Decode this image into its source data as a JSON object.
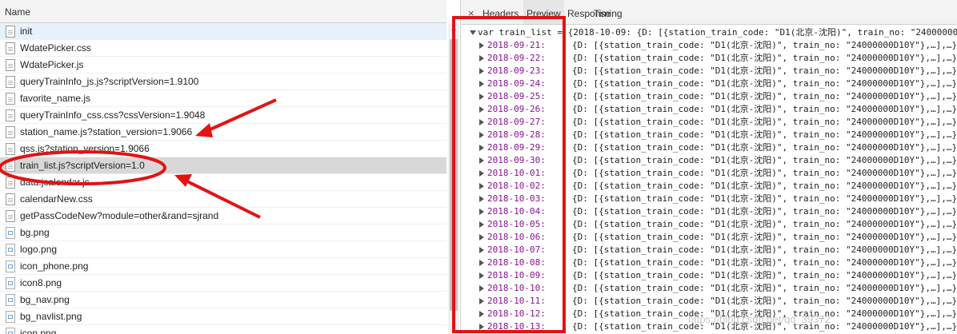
{
  "left_panel": {
    "header": "Name",
    "files": [
      {
        "name": "init",
        "icon": "document-icon"
      },
      {
        "name": "WdatePicker.css",
        "icon": "document-icon"
      },
      {
        "name": "WdatePicker.js",
        "icon": "document-icon"
      },
      {
        "name": "queryTrainInfo_js.js?scriptVersion=1.9100",
        "icon": "document-icon"
      },
      {
        "name": "favorite_name.js",
        "icon": "document-icon"
      },
      {
        "name": "queryTrainInfo_css.css?cssVersion=1.9048",
        "icon": "document-icon"
      },
      {
        "name": "station_name.js?station_version=1.9066",
        "icon": "document-icon"
      },
      {
        "name": "qss.js?station_version=1.9066",
        "icon": "document-icon"
      },
      {
        "name": "train_list.js?scriptVersion=1.0",
        "icon": "document-icon"
      },
      {
        "name": "data.jcalendar.js",
        "icon": "document-icon"
      },
      {
        "name": "calendarNew.css",
        "icon": "document-icon"
      },
      {
        "name": "getPassCodeNew?module=other&rand=sjrand",
        "icon": "document-icon"
      },
      {
        "name": "bg.png",
        "icon": "image-icon"
      },
      {
        "name": "logo.png",
        "icon": "image-icon"
      },
      {
        "name": "icon_phone.png",
        "icon": "image-icon"
      },
      {
        "name": "icon8.png",
        "icon": "image-icon"
      },
      {
        "name": "bg_nav.png",
        "icon": "image-icon"
      },
      {
        "name": "bg_navlist.png",
        "icon": "image-icon"
      },
      {
        "name": "icon.png",
        "icon": "image-icon"
      }
    ]
  },
  "right_panel": {
    "tabs": [
      "×",
      "Headers",
      "Preview",
      "Response",
      "Timing"
    ],
    "active_tab": "Preview",
    "root_line": "var train_list = {2018-10-09: {D: [{station_train_code: \"D1(北京-沈阳)\", train_no: \"24000000",
    "entries": [
      {
        "date": "2018-09-21:",
        "value": "{D: [{station_train_code: \"D1(北京-沈阳)\", train_no: \"24000000D10Y\"},…],…}"
      },
      {
        "date": "2018-09-22:",
        "value": "{D: [{station_train_code: \"D1(北京-沈阳)\", train_no: \"24000000D10Y\"},…],…}"
      },
      {
        "date": "2018-09-23:",
        "value": "{D: [{station_train_code: \"D1(北京-沈阳)\", train_no: \"24000000D10Y\"},…],…}"
      },
      {
        "date": "2018-09-24:",
        "value": "{D: [{station_train_code: \"D1(北京-沈阳)\", train_no: \"24000000D10Y\"},…],…}"
      },
      {
        "date": "2018-09-25:",
        "value": "{D: [{station_train_code: \"D1(北京-沈阳)\", train_no: \"24000000D10Y\"},…],…}"
      },
      {
        "date": "2018-09-26:",
        "value": "{D: [{station_train_code: \"D1(北京-沈阳)\", train_no: \"24000000D10Y\"},…],…}"
      },
      {
        "date": "2018-09-27:",
        "value": "{D: [{station_train_code: \"D1(北京-沈阳)\", train_no: \"24000000D10Y\"},…],…}"
      },
      {
        "date": "2018-09-28:",
        "value": "{D: [{station_train_code: \"D1(北京-沈阳)\", train_no: \"24000000D10Y\"},…],…}"
      },
      {
        "date": "2018-09-29:",
        "value": "{D: [{station_train_code: \"D1(北京-沈阳)\", train_no: \"24000000D10Y\"},…],…}"
      },
      {
        "date": "2018-09-30:",
        "value": "{D: [{station_train_code: \"D1(北京-沈阳)\", train_no: \"24000000D10Y\"},…],…}"
      },
      {
        "date": "2018-10-01:",
        "value": "{D: [{station_train_code: \"D1(北京-沈阳)\", train_no: \"24000000D10Y\"},…],…}"
      },
      {
        "date": "2018-10-02:",
        "value": "{D: [{station_train_code: \"D1(北京-沈阳)\", train_no: \"24000000D10Y\"},…],…}"
      },
      {
        "date": "2018-10-03:",
        "value": "{D: [{station_train_code: \"D1(北京-沈阳)\", train_no: \"24000000D10Y\"},…],…}"
      },
      {
        "date": "2018-10-04:",
        "value": "{D: [{station_train_code: \"D1(北京-沈阳)\", train_no: \"24000000D10Y\"},…],…}"
      },
      {
        "date": "2018-10-05:",
        "value": "{D: [{station_train_code: \"D1(北京-沈阳)\", train_no: \"24000000D10Y\"},…],…}"
      },
      {
        "date": "2018-10-06:",
        "value": "{D: [{station_train_code: \"D1(北京-沈阳)\", train_no: \"24000000D10Y\"},…],…}"
      },
      {
        "date": "2018-10-07:",
        "value": "{D: [{station_train_code: \"D1(北京-沈阳)\", train_no: \"24000000D10Y\"},…],…}"
      },
      {
        "date": "2018-10-08:",
        "value": "{D: [{station_train_code: \"D1(北京-沈阳)\", train_no: \"24000000D10Y\"},…],…}"
      },
      {
        "date": "2018-10-09:",
        "value": "{D: [{station_train_code: \"D1(北京-沈阳)\", train_no: \"24000000D10Y\"},…],…}"
      },
      {
        "date": "2018-10-10:",
        "value": "{D: [{station_train_code: \"D1(北京-沈阳)\", train_no: \"24000000D10Y\"},…],…}"
      },
      {
        "date": "2018-10-11:",
        "value": "{D: [{station_train_code: \"D1(北京-沈阳)\", train_no: \"24000000D10Y\"},…],…}"
      },
      {
        "date": "2018-10-12:",
        "value": "{D: [{station_train_code: \"D1(北京-沈阳)\", train_no: \"24000000D10Y\"},…],…}"
      },
      {
        "date": "2018-10-13:",
        "value": "{D: [{station_train_code: \"D1(北京-沈阳)\", train_no: \"24000000D10Y\"},…],…}"
      }
    ]
  },
  "watermark": "https://blog.csdn.net/qq_39372",
  "colors": {
    "annotation": "#e11414",
    "key": "#881391"
  }
}
